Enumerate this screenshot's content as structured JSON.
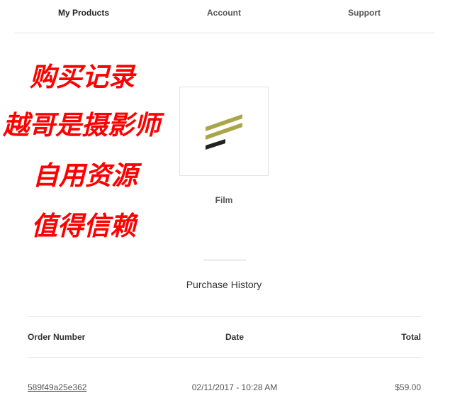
{
  "nav": {
    "items": [
      {
        "label": "My Products",
        "active": true
      },
      {
        "label": "Account",
        "active": false
      },
      {
        "label": "Support",
        "active": false
      }
    ]
  },
  "overlay_text": [
    "购买记录",
    "越哥是摄影师",
    "自用资源",
    "值得信赖"
  ],
  "overlay_color": "#ff0000",
  "product": {
    "name": "Film",
    "logo_icon": "film-stripes-logo",
    "logo_colors": {
      "stripe": "#a9a64a",
      "base": "#222222"
    }
  },
  "purchase_history": {
    "title": "Purchase History",
    "columns": [
      "Order Number",
      "Date",
      "Total"
    ],
    "rows": [
      {
        "order_number": "589f49a25e362",
        "date": "02/11/2017 - 10:28 AM",
        "total": "$59.00"
      }
    ]
  }
}
